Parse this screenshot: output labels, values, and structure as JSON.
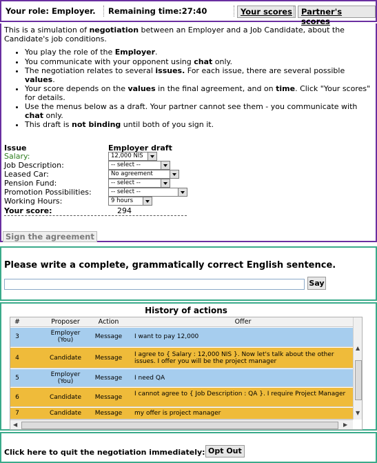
{
  "topbar": {
    "role": "Your role: Employer.",
    "remaining": "Remaining time:27:40",
    "your_scores": "Your scores",
    "partner_scores": "Partner's scores"
  },
  "intro": {
    "line1_pre": "This is a simulation of ",
    "line1_bold": "negotiation",
    "line1_post": " between an Employer and a Job Candidate, about the Candidate's job conditions.",
    "b1_pre": "You play the role of the ",
    "b1_bold": "Employer",
    "b1_post": ".",
    "b2_pre": "You communicate with your opponent using ",
    "b2_bold": "chat",
    "b2_post": " only.",
    "b3_pre": "The negotiation relates to several ",
    "b3_bold1": "issues.",
    "b3_mid": " For each issue, there are several possible ",
    "b3_bold2": "values",
    "b3_post": ".",
    "b4_pre": "Your score depends on the ",
    "b4_bold1": "values",
    "b4_mid": " in the final agreement, and on ",
    "b4_bold2": "time",
    "b4_post": ". Click \"Your scores\" for details.",
    "b5_pre": "Use the menus below as a draft. Your partner cannot see them - you communicate with ",
    "b5_bold": "chat",
    "b5_post": " only.",
    "b6_pre": "This draft is ",
    "b6_bold": "not binding",
    "b6_post": " until both of you sign it."
  },
  "draft": {
    "issue_header": "Issue",
    "draft_header": "Employer draft",
    "rows": [
      {
        "label": "Salary:",
        "value": "12,000 NIS"
      },
      {
        "label": "Job Description:",
        "value": "-- select --"
      },
      {
        "label": "Leased Car:",
        "value": "No agreement"
      },
      {
        "label": "Pension Fund:",
        "value": "-- select --"
      },
      {
        "label": "Promotion Possibilities:",
        "value": "-- select --"
      },
      {
        "label": "Working Hours:",
        "value": "9 hours"
      }
    ],
    "score_label": "Your score:",
    "score_value": "294",
    "sign_button": "Sign the agreement",
    "salary_color": "#2e7d1e"
  },
  "chat": {
    "title": "Please write a complete, grammatically correct English sentence.",
    "input_value": "",
    "say_button": "Say"
  },
  "history": {
    "title": "History of actions",
    "columns": [
      "#",
      "Proposer",
      "Action",
      "Offer"
    ],
    "rows": [
      {
        "num": "3",
        "proposer": "Employer (You)",
        "action": "Message",
        "offer": "I want to pay 12,000",
        "color": "blue"
      },
      {
        "num": "4",
        "proposer": "Candidate",
        "action": "Message",
        "offer": "I agree to { Salary : 12,000 NIS }. Now let's talk about the other issues. I offer you will be the project manager",
        "color": "orange"
      },
      {
        "num": "5",
        "proposer": "Employer (You)",
        "action": "Message",
        "offer": "I need QA",
        "color": "blue"
      },
      {
        "num": "6",
        "proposer": "Candidate",
        "action": "Message",
        "offer": "I cannot agree to { Job Description : QA }. I require Project Manager",
        "color": "orange"
      },
      {
        "num": "7",
        "proposer": "Candidate",
        "action": "Message",
        "offer": "my offer is project manager",
        "color": "orange"
      }
    ],
    "row_colors": {
      "blue": "#a6cdee",
      "orange": "#efbb3a"
    }
  },
  "optout": {
    "text": "Click here to quit the negotiation immediately:",
    "button": "Opt Out"
  }
}
